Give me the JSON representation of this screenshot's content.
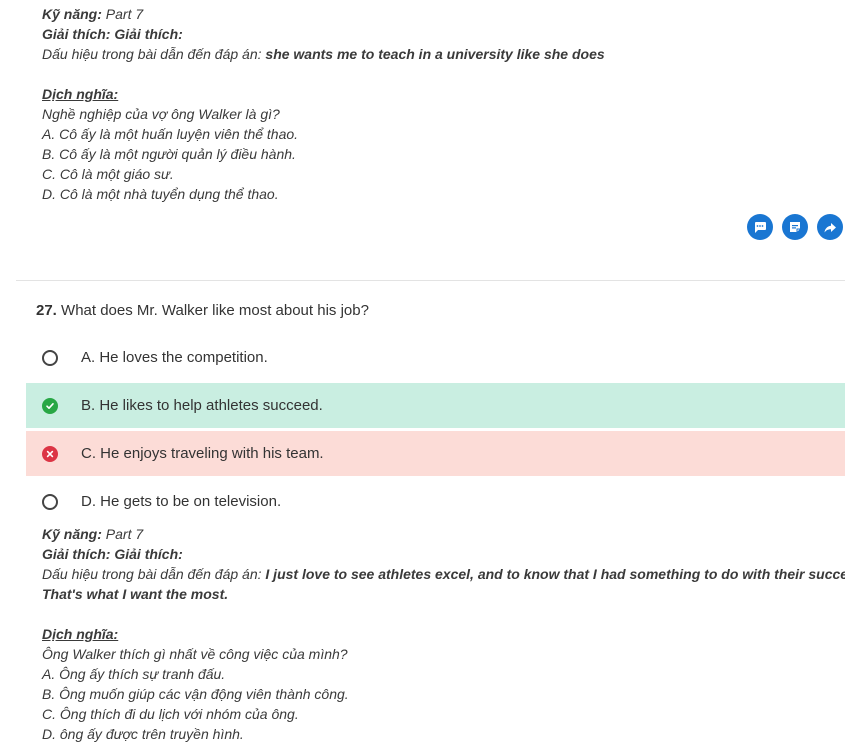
{
  "top_explanation": {
    "skill_label": "Kỹ năng:",
    "skill_value": "Part 7",
    "explain_label": "Giải thích:",
    "explain_value": "Giải thích:",
    "signal_prefix": "Dấu hiệu trong bài dẫn đến đáp án:",
    "signal_text": "she wants me to teach in a university like she does",
    "translation_label": "Dịch nghĩa:",
    "translation_lines": [
      "Nghề nghiệp của vợ ông Walker là gì?",
      "A. Cô ấy là một huấn luyện viên thể thao.",
      "B. Cô ấy là một người quản lý điều hành.",
      "C. Cô là một giáo sư.",
      "D. Cô là một nhà tuyển dụng thể thao."
    ]
  },
  "actions": {
    "icons": [
      "comment-icon",
      "note-icon",
      "share-icon"
    ],
    "color": "#1976d2"
  },
  "question": {
    "number": "27.",
    "text": "What does Mr. Walker like most about his job?",
    "options": [
      {
        "label": "A. He loves the competition.",
        "state": "none"
      },
      {
        "label": "B. He likes to help athletes succeed.",
        "state": "correct"
      },
      {
        "label": "C. He enjoys traveling with his team.",
        "state": "wrong"
      },
      {
        "label": "D. He gets to be on television.",
        "state": "none"
      }
    ],
    "colors": {
      "correct_bg": "#c9eee1",
      "wrong_bg": "#fcdcd7",
      "correct_icon": "#28a745",
      "wrong_icon": "#dc3545"
    }
  },
  "bottom_explanation": {
    "skill_label": "Kỹ năng:",
    "skill_value": "Part 7",
    "explain_label": "Giải thích:",
    "explain_value": "Giải thích:",
    "signal_prefix": "Dấu hiệu trong bài dẫn đến đáp án:",
    "signal_text_1": "I just love to see athletes excel, and to know that I had something to do with their success.",
    "signal_text_2": "That's what I want the most.",
    "translation_label": "Dịch nghĩa:",
    "translation_lines": [
      "Ông Walker thích gì nhất về công việc của mình?",
      "A. Ông ấy thích sự tranh đấu.",
      "B. Ông muốn giúp các vận động viên thành công.",
      "C. Ông thích đi du lịch với nhóm của ông.",
      "D. ông ấy được trên truyền hình."
    ]
  }
}
